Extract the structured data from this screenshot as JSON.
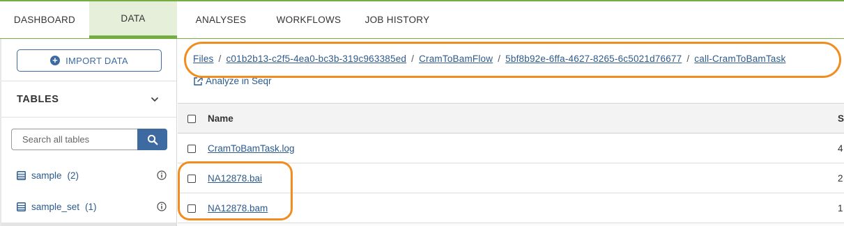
{
  "nav": {
    "tabs": [
      {
        "label": "DASHBOARD"
      },
      {
        "label": "DATA"
      },
      {
        "label": "ANALYSES"
      },
      {
        "label": "WORKFLOWS"
      },
      {
        "label": "JOB HISTORY"
      }
    ],
    "active": "DATA"
  },
  "sidebar": {
    "import_label": "IMPORT DATA",
    "tables_label": "TABLES",
    "search_placeholder": "Search all tables",
    "tables": [
      {
        "name": "sample",
        "count": "(2)"
      },
      {
        "name": "sample_set",
        "count": "(1)"
      }
    ]
  },
  "breadcrumb": {
    "parts": [
      "Files",
      "c01b2b13-c2f5-4ea0-bc3b-319c963385ed",
      "CramToBamFlow",
      "5bf8b92e-6ffa-4627-8265-6c5021d76677",
      "call-CramToBamTask"
    ],
    "separator": "/"
  },
  "analyze_label": "Analyze in Seqr",
  "file_table": {
    "columns": [
      "Name",
      "S"
    ],
    "rows": [
      {
        "name": "CramToBamTask.log",
        "size": "4"
      },
      {
        "name": "NA12878.bai",
        "size": "2"
      },
      {
        "name": "NA12878.bam",
        "size": "1"
      }
    ]
  },
  "colors": {
    "accent_green": "#74ae43",
    "link_blue": "#2b5a8c",
    "button_blue": "#3d6aa1",
    "highlight_orange": "#f28c1f"
  }
}
